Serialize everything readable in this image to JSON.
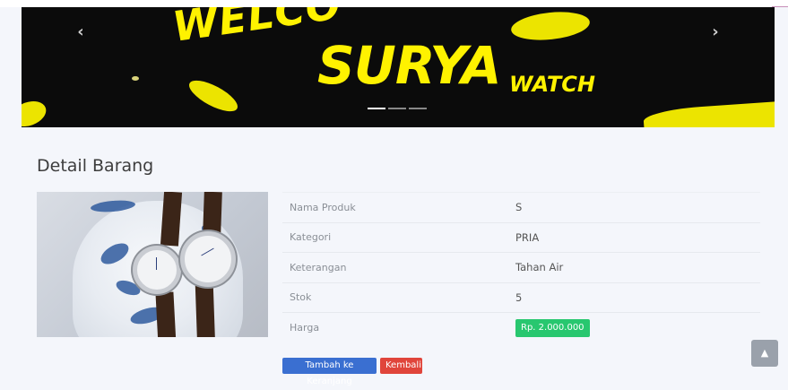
{
  "carousel": {
    "banner_text": "WELCO",
    "brand_text": "SURYA",
    "brand_suffix": "WATCH",
    "prev_icon": "chevron-left-icon",
    "next_icon": "chevron-right-icon",
    "prev_glyph": "‹",
    "next_glyph": "›",
    "slide_count": 3,
    "active_slide": 1
  },
  "page": {
    "title": "Detail Barang"
  },
  "product": {
    "image_alt": "two wrist watches with leather straps beside a blue and white porcelain vase",
    "rows": [
      {
        "label": "Nama Produk",
        "value": "S"
      },
      {
        "label": "Kategori",
        "value": "PRIA"
      },
      {
        "label": "Keterangan",
        "value": "Tahan Air"
      },
      {
        "label": "Stok",
        "value": "5"
      },
      {
        "label": "Harga",
        "value": "Rp. 2.000.000"
      }
    ]
  },
  "actions": {
    "add_to_cart": "Tambah ke Keranjang",
    "back": "Kembali"
  },
  "scroll_top": {
    "icon": "chevron-up-icon",
    "glyph": "▲"
  },
  "colors": {
    "banner_bg": "#0b0b0b",
    "brand_yellow": "#fff200",
    "price_badge": "#28c76f",
    "cart_button": "#3a6fd1",
    "back_button": "#e0453b"
  }
}
